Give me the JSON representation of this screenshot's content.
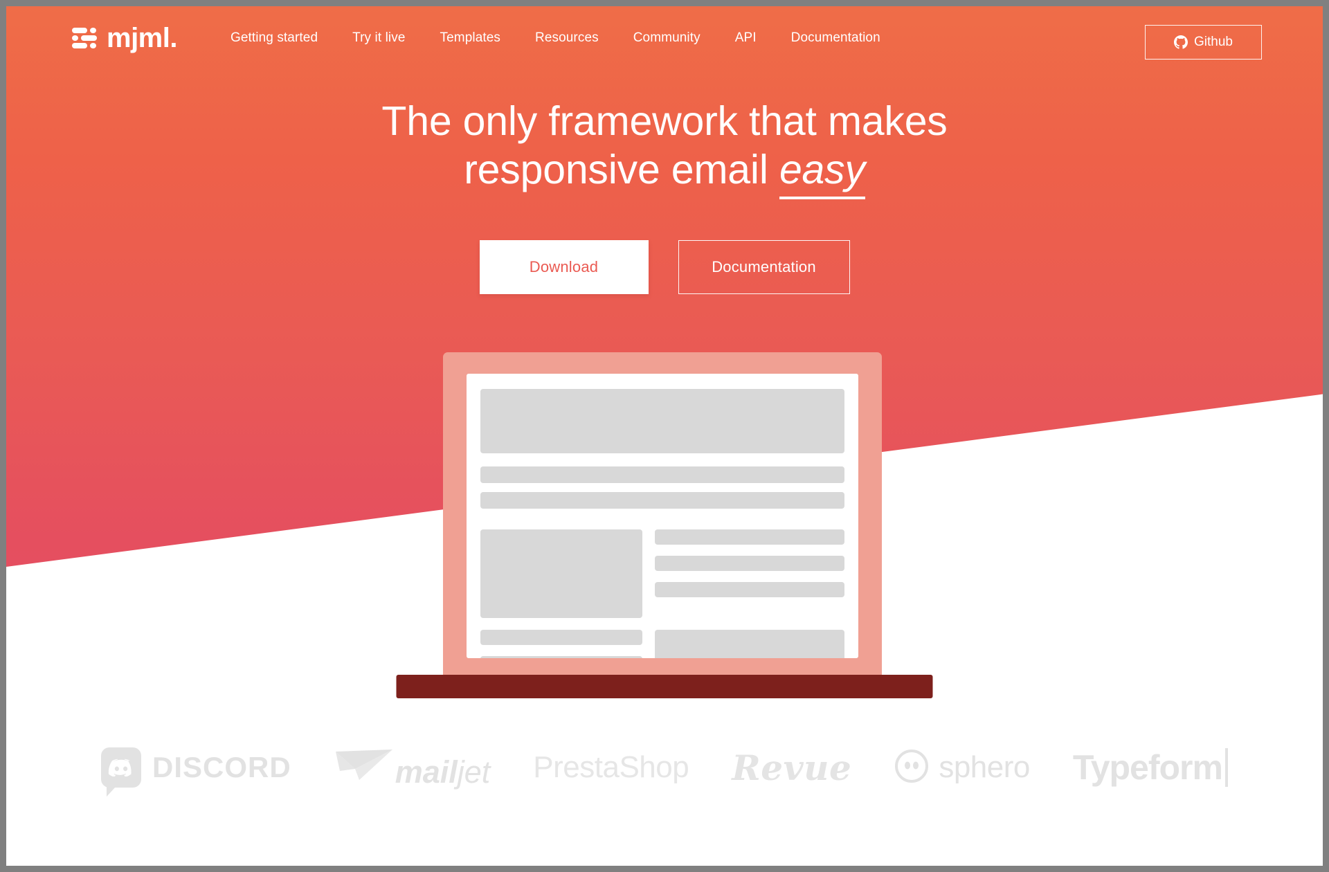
{
  "brand": {
    "name": "mjml.",
    "logo_icon": "mjml-bars-logo-icon"
  },
  "nav": {
    "links": [
      {
        "label": "Getting started"
      },
      {
        "label": "Try it live"
      },
      {
        "label": "Templates"
      },
      {
        "label": "Resources"
      },
      {
        "label": "Community"
      },
      {
        "label": "API"
      },
      {
        "label": "Documentation"
      }
    ],
    "github": {
      "label": "Github",
      "icon": "github-icon"
    }
  },
  "hero": {
    "title_line_1": "The only framework that makes",
    "title_line_2_prefix": "responsive email ",
    "title_emphasis": "easy",
    "buttons": {
      "primary": "Download",
      "secondary": "Documentation"
    }
  },
  "illustration": {
    "name": "laptop-email-mockup"
  },
  "customers": {
    "logos": [
      {
        "name": "discord",
        "label": "DISCORD",
        "icon": "discord-icon"
      },
      {
        "name": "mailjet",
        "label_bold": "mail",
        "label_light": "jet",
        "icon": "mailjet-plane-icon"
      },
      {
        "name": "prestashop",
        "label": "PrestaShop"
      },
      {
        "name": "revue",
        "label": "Revue"
      },
      {
        "name": "sphero",
        "label": "sphero",
        "icon": "sphero-ball-icon"
      },
      {
        "name": "typeform",
        "label": "Typeform"
      }
    ]
  },
  "colors": {
    "gradient_top": "#ef6d48",
    "gradient_bottom": "#e54d63",
    "accent": "#ea5a52",
    "laptop_lid": "#f0a093",
    "laptop_base": "#7d201c",
    "skeleton_block": "#d8d8d8",
    "logo_gray": "#e2e2e2",
    "page_background": "#ffffff"
  }
}
